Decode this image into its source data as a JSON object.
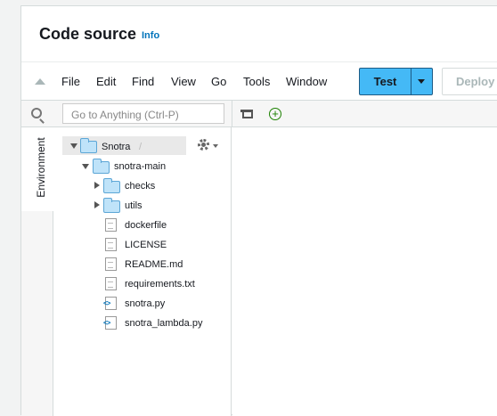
{
  "header": {
    "title": "Code source",
    "info_label": "Info"
  },
  "menu": [
    "File",
    "Edit",
    "Find",
    "View",
    "Go",
    "Tools",
    "Window"
  ],
  "buttons": {
    "test_label": "Test",
    "deploy_label": "Deploy"
  },
  "search": {
    "placeholder": "Go to Anything (Ctrl-P)"
  },
  "sidebar": {
    "environment_tab": "Environment"
  },
  "tree": {
    "root": {
      "label": "Snotra",
      "separator": "/"
    },
    "items": [
      {
        "label": "snotra-main",
        "type": "folder",
        "expanded": true
      },
      {
        "label": "checks",
        "type": "folder",
        "expanded": false
      },
      {
        "label": "utils",
        "type": "folder",
        "expanded": false
      },
      {
        "label": "dockerfile",
        "type": "file"
      },
      {
        "label": "LICENSE",
        "type": "file"
      },
      {
        "label": "README.md",
        "type": "file"
      },
      {
        "label": "requirements.txt",
        "type": "file"
      },
      {
        "label": "snotra.py",
        "type": "python"
      },
      {
        "label": "snotra_lambda.py",
        "type": "python"
      }
    ]
  },
  "icons": {
    "collapse": "collapse-up-icon",
    "search": "search-icon",
    "list": "file-list-icon",
    "add": "plus-circle-icon",
    "gear": "gear-icon"
  },
  "colors": {
    "accent": "#44b9f6",
    "link": "#0073bb",
    "folder": "#bfe3f9",
    "add": "#1d8102"
  }
}
